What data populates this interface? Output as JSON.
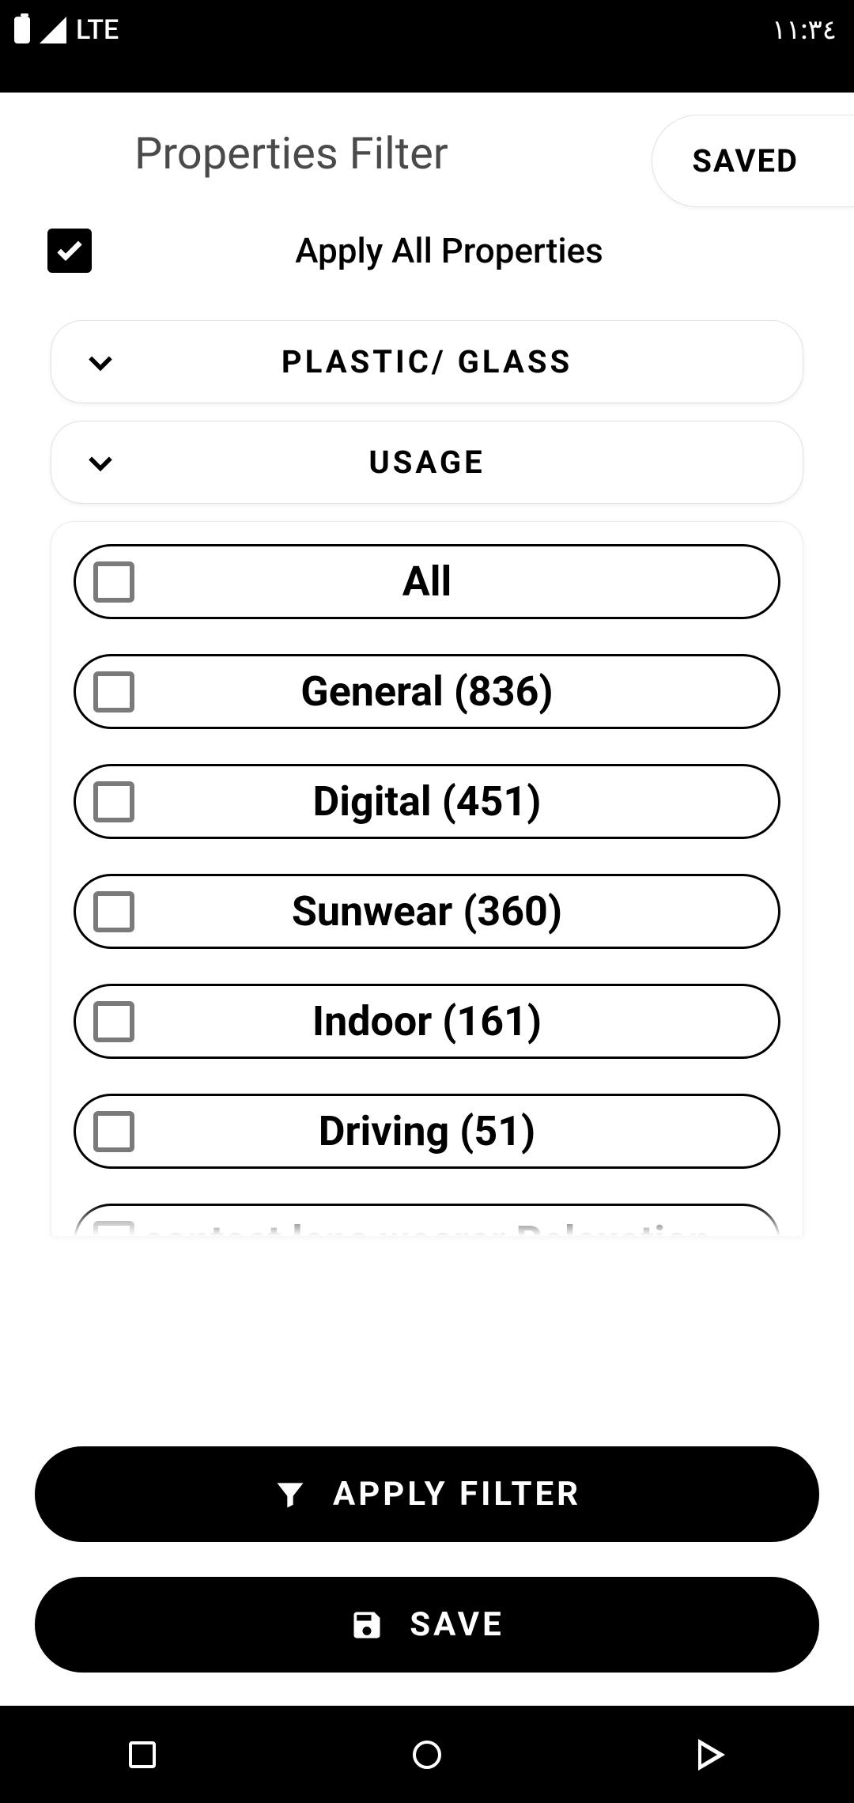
{
  "statusbar": {
    "network": "LTE",
    "time": "١١:٣٤"
  },
  "header": {
    "title": "Properties Filter",
    "saved_label": "SAVED"
  },
  "apply_all": {
    "label": "Apply All Properties",
    "checked": true
  },
  "sections": {
    "plastic_glass": {
      "label": "PLASTIC/ GLASS"
    },
    "usage": {
      "label": "USAGE"
    }
  },
  "usage_options": [
    {
      "label": "All",
      "checked": false
    },
    {
      "label": "General (836)",
      "checked": false
    },
    {
      "label": "Digital (451)",
      "checked": false
    },
    {
      "label": "Sunwear (360)",
      "checked": false
    },
    {
      "label": "Indoor (161)",
      "checked": false
    },
    {
      "label": "Driving (51)",
      "checked": false
    },
    {
      "label": "contact lens wearer Relaxation",
      "checked": false
    }
  ],
  "buttons": {
    "apply_filter": "APPLY FILTER",
    "save": "SAVE"
  }
}
